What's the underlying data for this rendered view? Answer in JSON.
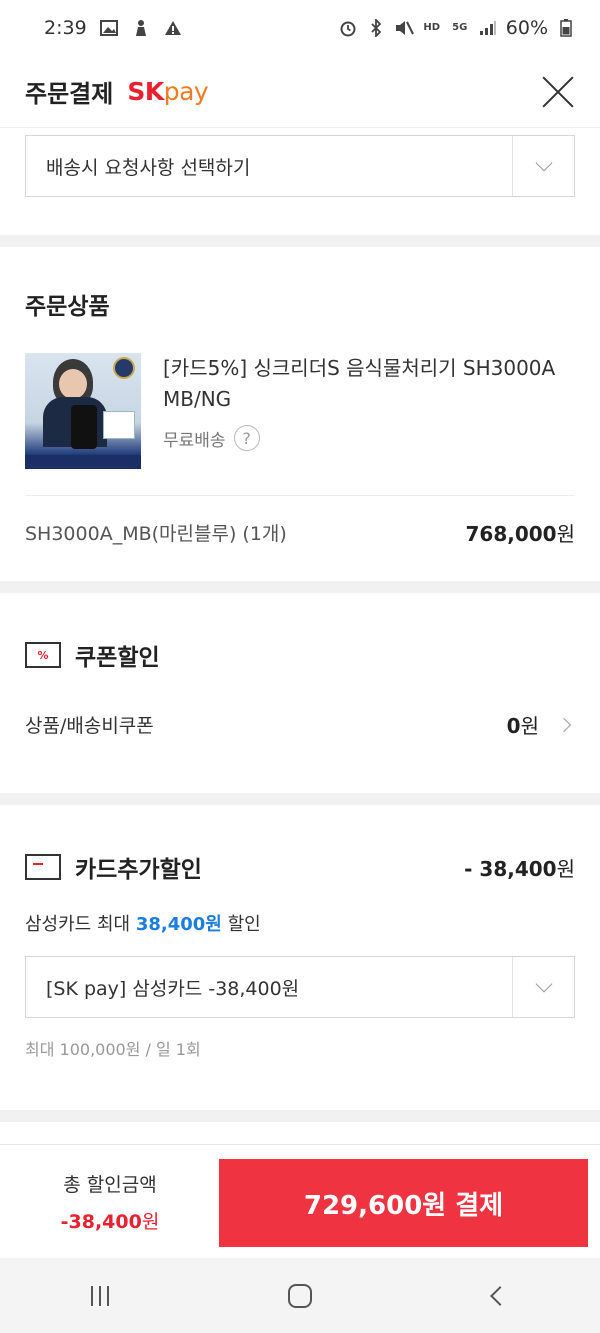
{
  "status_bar": {
    "time": "2:39",
    "battery": "60%",
    "icons_left": [
      "gallery-icon",
      "hand-icon",
      "warning-icon"
    ],
    "icons_right": [
      "alarm-icon",
      "bluetooth-icon",
      "mute-icon",
      "hd-voice-icon",
      "5g-icon",
      "signal-icon",
      "battery-icon"
    ],
    "hd_label": "HD",
    "g5_label": "5G"
  },
  "header": {
    "title": "주문결제",
    "brand_sk": "SK",
    "brand_pay": "pay"
  },
  "delivery": {
    "select_text": "배송시 요청사항 선택하기"
  },
  "order_items": {
    "title": "주문상품",
    "product_name": "[카드5%] 싱크리더S 음식물처리기 SH3000A MB/NG",
    "shipping": "무료배송",
    "help_icon_text": "?",
    "option": "SH3000A_MB(마린블루) (1개)",
    "price": "768,000",
    "price_unit": "원"
  },
  "coupon": {
    "title": "쿠폰할인",
    "icon_text": "%",
    "row_label": "상품/배송비쿠폰",
    "row_value": "0",
    "row_unit": "원"
  },
  "card_discount": {
    "title": "카드추가할인",
    "amount": "- 38,400",
    "amount_unit": "원",
    "note_prefix": "삼성카드 최대",
    "note_highlight": "38,400원",
    "note_suffix": "할인",
    "select_text": "[SK pay] 삼성카드 -38,400원",
    "limit_text": "최대 100,000원 / 일 1회"
  },
  "bottom": {
    "total_label": "총 할인금액",
    "total_value": "-38,400",
    "total_unit": "원",
    "pay_button": "729,600원 결제"
  },
  "colors": {
    "accent_red": "#ef3341",
    "sk_red": "#e8202f",
    "pay_orange": "#f47a20",
    "highlight_blue": "#1a7de0"
  }
}
